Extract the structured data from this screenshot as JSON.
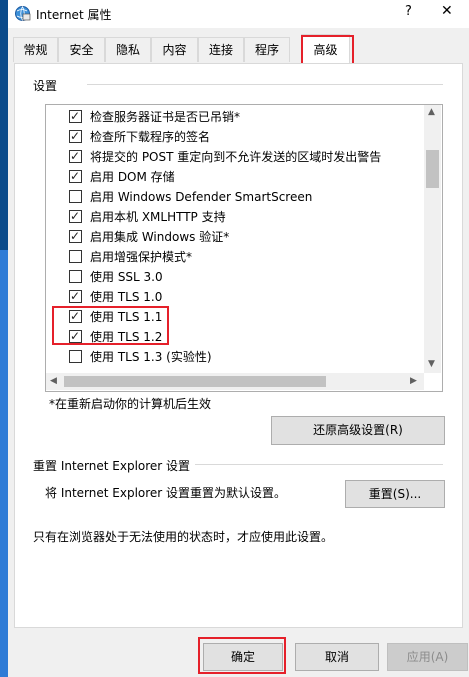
{
  "window": {
    "title": "Internet 属性",
    "help": "?",
    "close": "✕"
  },
  "tabs": [
    {
      "label": "常规"
    },
    {
      "label": "安全"
    },
    {
      "label": "隐私"
    },
    {
      "label": "内容"
    },
    {
      "label": "连接"
    },
    {
      "label": "程序"
    },
    {
      "label": "高级",
      "active": true
    }
  ],
  "settings": {
    "group_label": "设置",
    "items": [
      {
        "label": "检查服务器证书是否已吊销*",
        "checked": true
      },
      {
        "label": "检查所下载程序的签名",
        "checked": true
      },
      {
        "label": "将提交的 POST 重定向到不允许发送的区域时发出警告",
        "checked": true
      },
      {
        "label": "启用 DOM 存储",
        "checked": true
      },
      {
        "label": "启用 Windows Defender SmartScreen",
        "checked": false
      },
      {
        "label": "启用本机 XMLHTTP 支持",
        "checked": true
      },
      {
        "label": "启用集成 Windows 验证*",
        "checked": true
      },
      {
        "label": "启用增强保护模式*",
        "checked": false
      },
      {
        "label": "使用 SSL 3.0",
        "checked": false
      },
      {
        "label": "使用 TLS 1.0",
        "checked": true
      },
      {
        "label": "使用 TLS 1.1",
        "checked": true
      },
      {
        "label": "使用 TLS 1.2",
        "checked": true
      },
      {
        "label": "使用 TLS 1.3 (实验性)",
        "checked": false
      }
    ],
    "note": "*在重新启动你的计算机后生效",
    "restore_button": "还原高级设置(R)"
  },
  "reset": {
    "group_label": "重置 Internet Explorer 设置",
    "description": "将 Internet Explorer 设置重置为默认设置。",
    "button": "重置(S)...",
    "note": "只有在浏览器处于无法使用的状态时，才应使用此设置。"
  },
  "footer": {
    "ok": "确定",
    "cancel": "取消",
    "apply": "应用(A)"
  },
  "colors": {
    "highlight_box": "#e5202a",
    "taskbar": "#2e7bd6"
  }
}
